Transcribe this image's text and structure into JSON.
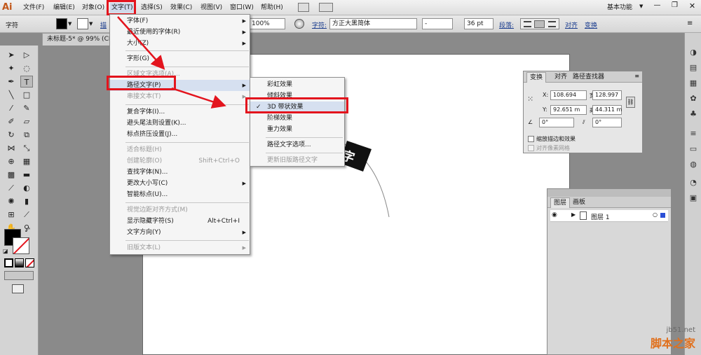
{
  "app": {
    "logo": "Ai",
    "workspace": "基本功能"
  },
  "menubar": {
    "items": [
      "文件(F)",
      "编辑(E)",
      "对象(O)",
      "文字(T)",
      "选择(S)",
      "效果(C)",
      "视图(V)",
      "窗口(W)",
      "帮助(H)"
    ]
  },
  "options_bar": {
    "label": "字符",
    "zoom_value": "100%",
    "char_link": "字符:",
    "font_family": "方正大黑简体",
    "font_style": "-",
    "font_size": "36 pt",
    "paragraph_link": "段落:",
    "align_link": "对齐",
    "transform_link": "变换",
    "stroke_partial": "描"
  },
  "document_tab": {
    "title": "未标题-5* @ 99% (CM"
  },
  "type_menu": {
    "items": [
      {
        "label": "字体(F)",
        "arrow": true
      },
      {
        "label": "最近使用的字体(R)",
        "arrow": true
      },
      {
        "label": "大小(Z)",
        "arrow": true
      },
      {
        "label": "字形(G)"
      },
      {
        "label": "区域文字选项(A)...",
        "disabled": true
      },
      {
        "label": "路径文字(P)",
        "arrow": true
      },
      {
        "label": "串接文本(T)",
        "arrow": true,
        "disabled": true
      },
      {
        "label": "复合字体(I)..."
      },
      {
        "label": "避头尾法则设置(K)..."
      },
      {
        "label": "标点挤压设置(J)..."
      },
      {
        "label": "适合标题(H)",
        "disabled": true
      },
      {
        "label": "创建轮廓(O)",
        "shortcut": "Shift+Ctrl+O",
        "disabled": true
      },
      {
        "label": "查找字体(N)..."
      },
      {
        "label": "更改大小写(C)",
        "arrow": true
      },
      {
        "label": "智能标点(U)..."
      },
      {
        "label": "视觉边距对齐方式(M)",
        "disabled": true
      },
      {
        "label": "显示隐藏字符(S)",
        "shortcut": "Alt+Ctrl+I"
      },
      {
        "label": "文字方向(Y)",
        "arrow": true
      },
      {
        "label": "旧版文本(L)",
        "arrow": true,
        "disabled": true
      }
    ]
  },
  "path_type_submenu": {
    "items": [
      {
        "label": "彩虹效果"
      },
      {
        "label": "倾斜效果"
      },
      {
        "label": "3D 带状效果",
        "checked": true,
        "check": "✓"
      },
      {
        "label": "阶梯效果"
      },
      {
        "label": "重力效果"
      },
      {
        "label": "路径文字选项..."
      },
      {
        "label": "更新旧版路径文字",
        "disabled": true
      }
    ]
  },
  "transform_panel": {
    "tabs": [
      "变换",
      "对齐",
      "路径查找器"
    ],
    "x_label": "X:",
    "x": "108.694",
    "y_label": "Y:",
    "y": "92.651 m",
    "w_label": "宽:",
    "w": "128.997",
    "h_label": "高:",
    "h": "44.311 m",
    "rotate": "0°",
    "shear": "0°",
    "scale_strokes": "缩放描边和效果",
    "align_pixel": "对齐像素网格"
  },
  "layers_panel": {
    "tabs": [
      "图层",
      "画板"
    ],
    "layer_name": "图层 1"
  },
  "canvas": {
    "text_fragment": "字"
  },
  "watermark": {
    "site": "jb51.net",
    "name": "脚本之家"
  },
  "colors": {
    "accent_red": "#e3141d",
    "menu_hl": "#d6e0f0",
    "logo": "#c2571a"
  }
}
